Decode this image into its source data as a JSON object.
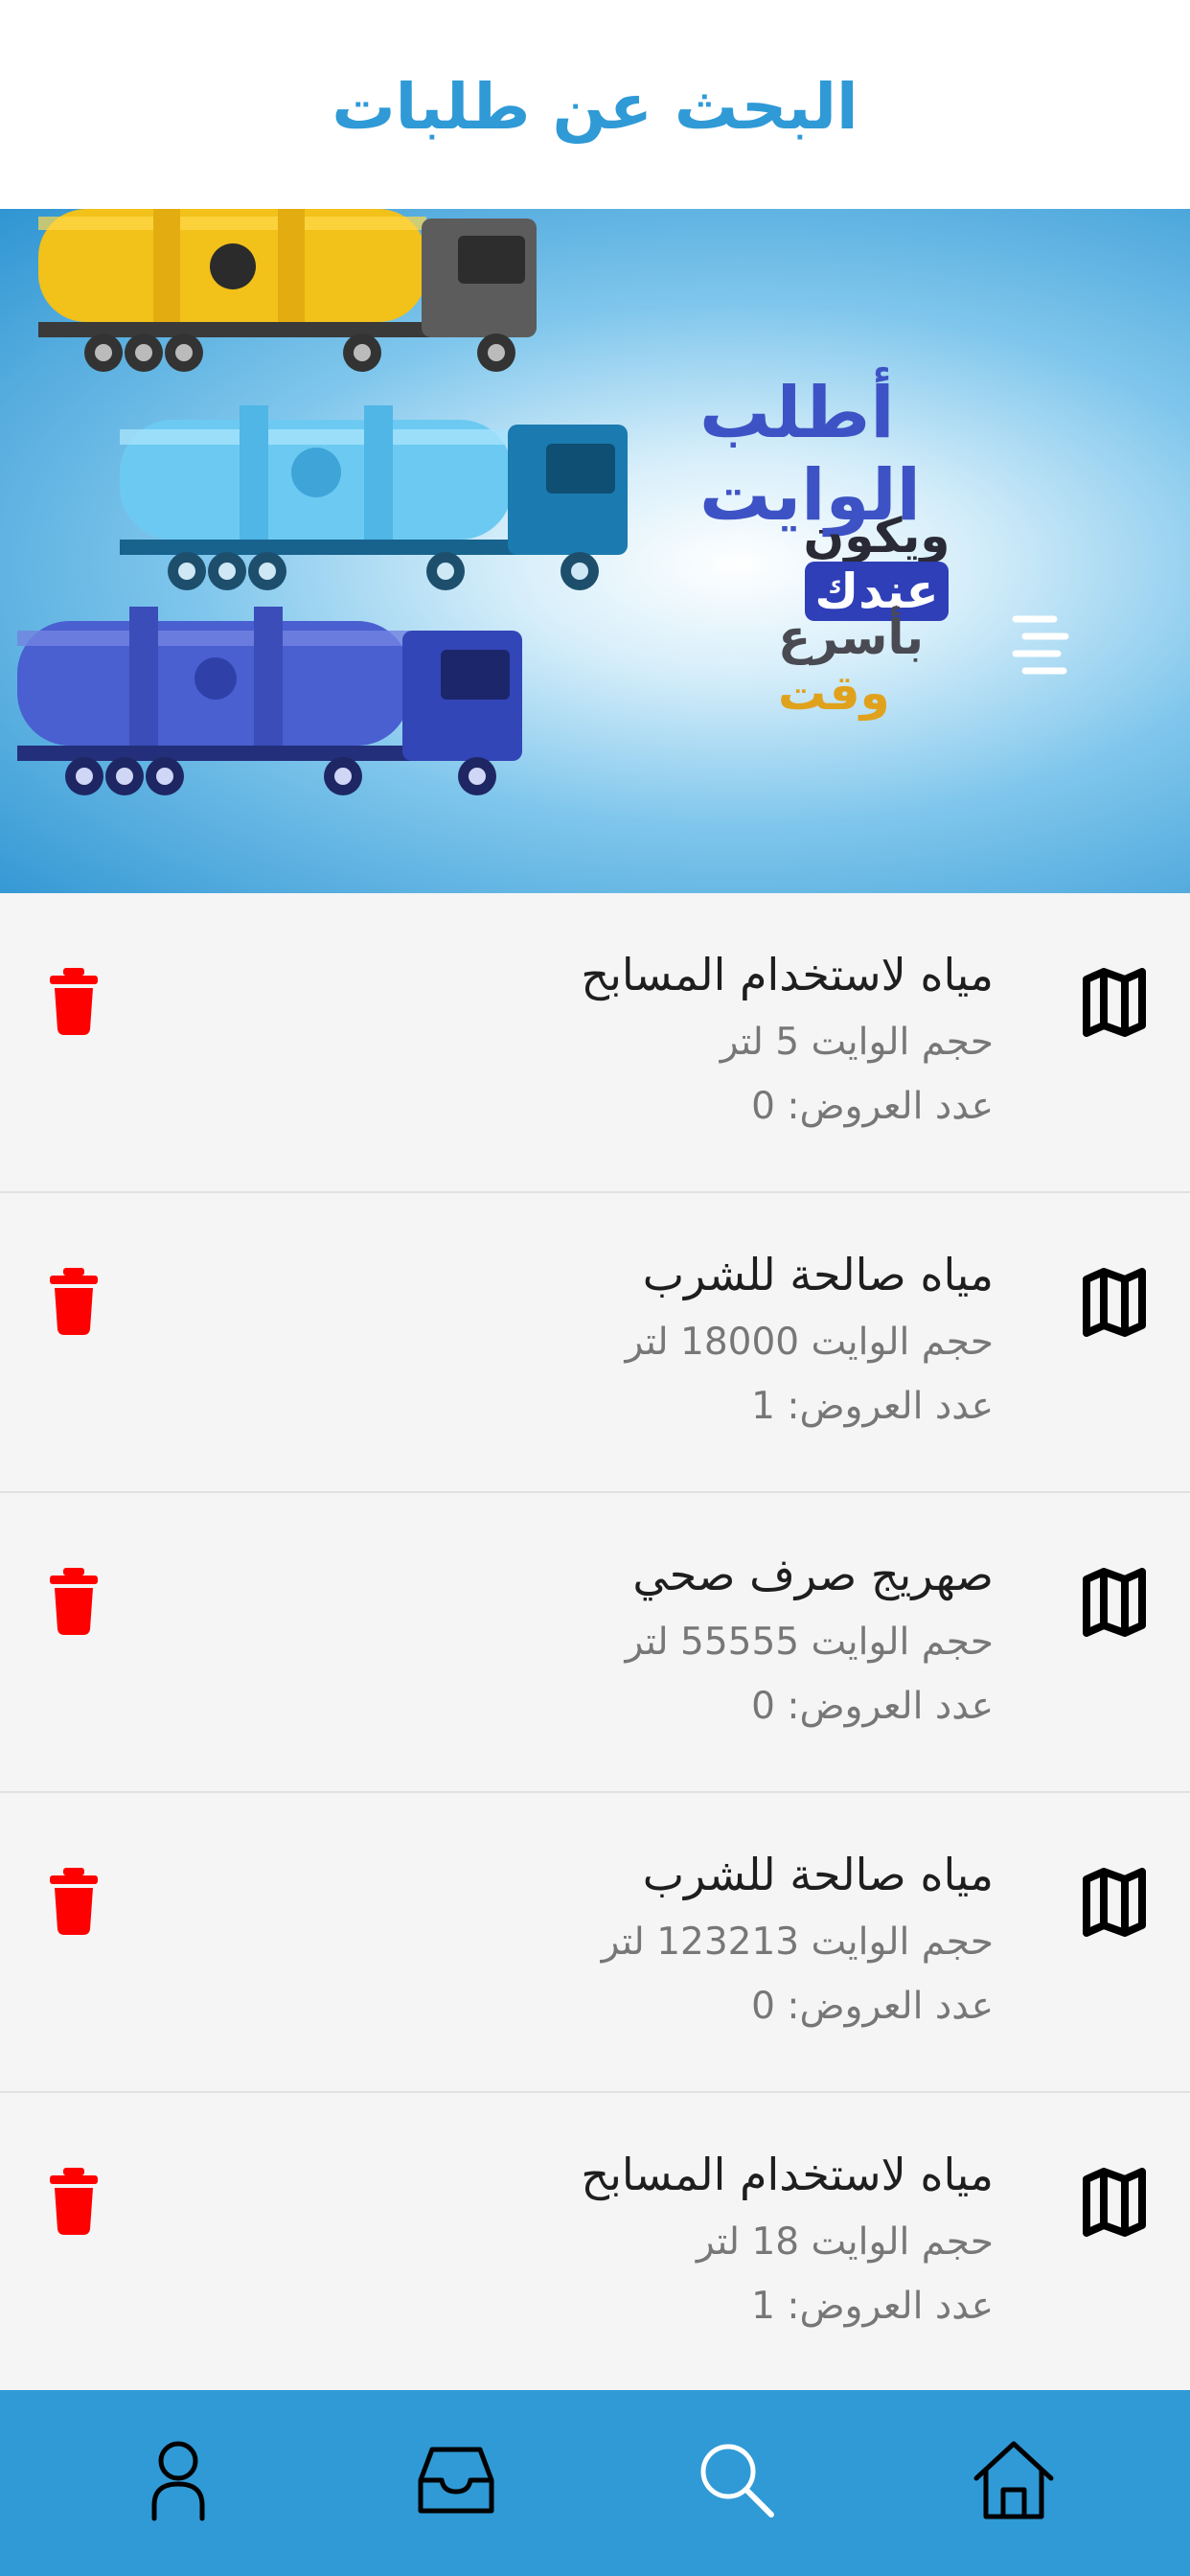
{
  "header": {
    "title": "البحث عن طلبات"
  },
  "banner": {
    "line1": "أطلب الوايت",
    "line2_prefix": "ويكون",
    "line2_highlight": "عندك",
    "line3_prefix": "بأسرع",
    "line3_gold": "وقت",
    "slides_count": 2,
    "active_slide": 2
  },
  "requests": [
    {
      "title": "مياه لاستخدام المسابح",
      "size": "حجم الوايت 5 لتر",
      "offers": "عدد العروض: 0"
    },
    {
      "title": "مياه صالحة للشرب",
      "size": "حجم الوايت 18000 لتر",
      "offers": "عدد العروض: 1"
    },
    {
      "title": "صهريج صرف صحي",
      "size": "حجم الوايت 55555 لتر",
      "offers": "عدد العروض: 0"
    },
    {
      "title": "مياه صالحة للشرب",
      "size": "حجم الوايت 123213 لتر",
      "offers": "عدد العروض: 0"
    },
    {
      "title": "مياه لاستخدام المسابح",
      "size": "حجم الوايت 18 لتر",
      "offers": "عدد العروض: 1"
    }
  ],
  "tabbar": {
    "items": [
      "profile-icon",
      "inbox-icon",
      "search-icon",
      "home-icon"
    ]
  },
  "colors": {
    "accent": "#2f9ad6",
    "delete": "#ff0000",
    "background": "#f5f5f5"
  }
}
